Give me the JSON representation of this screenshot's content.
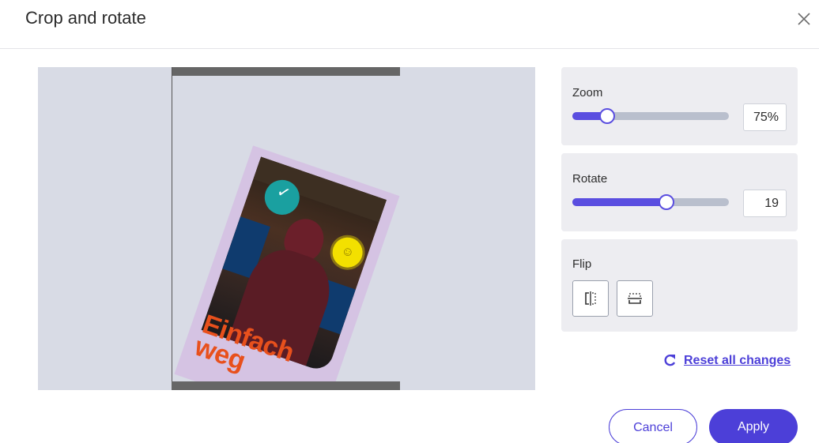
{
  "dialog": {
    "title": "Crop and rotate",
    "close_icon": "close-icon"
  },
  "preview": {
    "cover": {
      "title": "Einfach weg",
      "badge_text": "",
      "subtitle": ""
    }
  },
  "controls": {
    "zoom": {
      "label": "Zoom",
      "value_text": "75%",
      "level": 0.22
    },
    "rotate": {
      "label": "Rotate",
      "value_text": "19",
      "level": 0.6
    },
    "flip": {
      "label": "Flip",
      "horizontal_icon": "flip-horizontal-icon",
      "vertical_icon": "flip-vertical-icon"
    }
  },
  "reset": {
    "icon": "refresh-icon",
    "label": "Reset all changes"
  },
  "footer": {
    "cancel_label": "Cancel",
    "apply_label": "Apply"
  },
  "colors": {
    "accent": "#4c3fd8",
    "panel_bg": "#ededf1",
    "canvas_bg": "#d8dbe5"
  }
}
